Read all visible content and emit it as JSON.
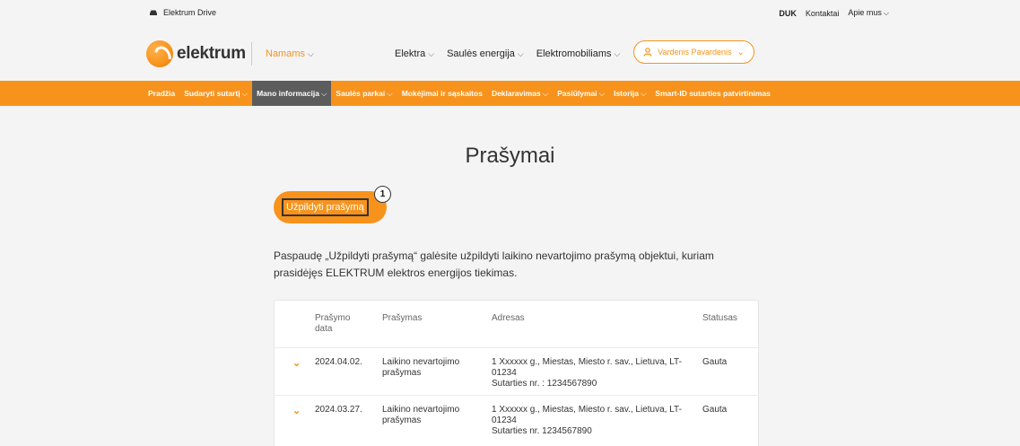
{
  "topbar": {
    "drive_label": "Elektrum Drive",
    "links": [
      "DUK",
      "Kontaktai",
      "Apie mus"
    ]
  },
  "header": {
    "logo_text": "elektrum",
    "segment": "Namams",
    "nav": [
      "Elektra",
      "Saulės energija",
      "Elektromobiliams"
    ],
    "user_name": "Vardenis Pavardenis"
  },
  "orange_nav": [
    "Pradžia",
    "Sudaryti sutartį",
    "Mano informacija",
    "Saulės parkai",
    "Mokėjimai ir sąskaitos",
    "Deklaravimas",
    "Pasiūlymai",
    "Istorija",
    "Smart-ID sutarties patvirtinimas"
  ],
  "page": {
    "title": "Prašymai",
    "fill_button": "Užpildyti prašymą",
    "badge": "1",
    "description": "Paspaudę „Užpildyti prašymą“ galėsite užpildyti laikino nevartojimo prašymą objektui, kuriam prasidėjęs ELEKTRUM elektros energijos tiekimas."
  },
  "table": {
    "headers": [
      "Prašymo data",
      "Prašymas",
      "Adresas",
      "Statusas"
    ],
    "rows": [
      {
        "date": "2024.04.02.",
        "request": "Laikino nevartojimo prašymas",
        "address": "1  Xxxxxx g., Miestas, Miesto r. sav., Lietuva, LT-01234",
        "contract": "Sutarties nr. : 1234567890",
        "status": "Gauta"
      },
      {
        "date": "2024.03.27.",
        "request": "Laikino nevartojimo prašymas",
        "address": "1  Xxxxxx g., Miestas, Miesto r. sav., Lietuva, LT-01234",
        "contract": "Sutarties nr.  1234567890",
        "status": "Gauta"
      }
    ]
  },
  "colors": {
    "accent": "#f7931d",
    "active_nav": "#5c5c5c"
  }
}
